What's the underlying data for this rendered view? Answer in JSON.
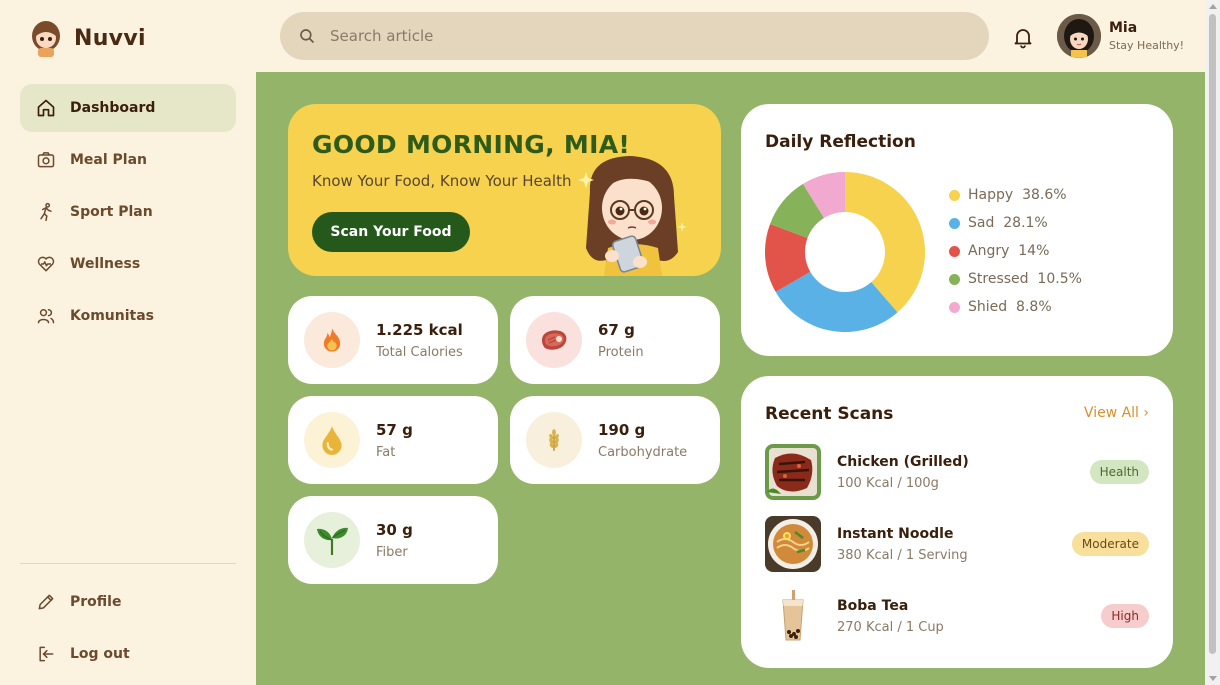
{
  "brand": {
    "name": "Nuvvi"
  },
  "nav": {
    "items": [
      {
        "label": "Dashboard",
        "icon": "home-icon",
        "active": true
      },
      {
        "label": "Meal Plan",
        "icon": "camera-icon"
      },
      {
        "label": "Sport Plan",
        "icon": "runner-icon"
      },
      {
        "label": "Wellness",
        "icon": "heart-pulse-icon"
      },
      {
        "label": "Komunitas",
        "icon": "users-icon"
      }
    ],
    "bottom": [
      {
        "label": "Profile",
        "icon": "pencil-icon"
      },
      {
        "label": "Log out",
        "icon": "logout-icon"
      }
    ]
  },
  "search": {
    "placeholder": "Search article"
  },
  "user": {
    "name": "Mia",
    "subtitle": "Stay Healthy!"
  },
  "greeting": {
    "title": "GOOD MORNING, MIA!",
    "subtitle": "Know Your Food, Know Your Health",
    "button": "Scan Your Food"
  },
  "stats": [
    {
      "value": "1.225 kcal",
      "label": "Total Calories",
      "icon": "fire-icon",
      "bg": "#fbe9dc"
    },
    {
      "value": "67 g",
      "label": "Protein",
      "icon": "steak-icon",
      "bg": "#fbe1de"
    },
    {
      "value": "57 g",
      "label": "Fat",
      "icon": "oil-drop-icon",
      "bg": "#fcf2d6"
    },
    {
      "value": "190 g",
      "label": "Carbohydrate",
      "icon": "wheat-icon",
      "bg": "#f8f0dc"
    },
    {
      "value": "30 g",
      "label": "Fiber",
      "icon": "sprout-icon",
      "bg": "#e6f0da"
    }
  ],
  "reflection": {
    "title": "Daily Reflection",
    "chart_data": {
      "type": "pie",
      "categories": [
        "Happy",
        "Sad",
        "Angry",
        "Stressed",
        "Shied"
      ],
      "values": [
        38.6,
        28.1,
        14,
        10.5,
        8.8
      ],
      "value_labels": [
        "38.6%",
        "28.1%",
        "14%",
        "10.5%",
        "8.8%"
      ],
      "colors": [
        "#f6d24e",
        "#5ab1e6",
        "#e2544a",
        "#86b25a",
        "#f2a9cf"
      ],
      "legend": "right"
    }
  },
  "recent": {
    "title": "Recent Scans",
    "view_all": "View All ›",
    "items": [
      {
        "name": "Chicken (Grilled)",
        "meta": "100 Kcal / 100g",
        "badge": "Health",
        "badge_bg": "#d3e6c2",
        "badge_color": "#4a6a2e",
        "img": "grilled-chicken"
      },
      {
        "name": "Instant Noodle",
        "meta": "380 Kcal / 1 Serving",
        "badge": "Moderate",
        "badge_bg": "#f8df9c",
        "badge_color": "#6b4a10",
        "img": "noodle-bowl"
      },
      {
        "name": "Boba Tea",
        "meta": "270 Kcal / 1 Cup",
        "badge": "High",
        "badge_bg": "#f6cccc",
        "badge_color": "#8a2a2a",
        "img": "boba-tea"
      }
    ]
  }
}
